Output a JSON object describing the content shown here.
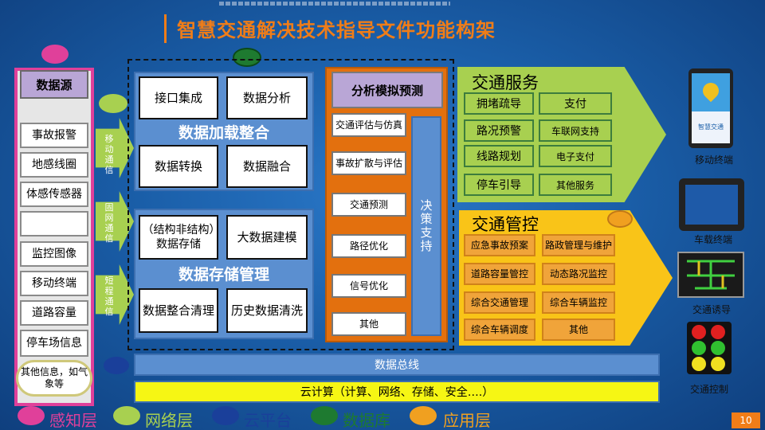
{
  "title": "智慧交通解决技术指导文件功能构架",
  "source": {
    "header": "数据源",
    "items": [
      "事故报警",
      "地感线圈",
      "体感传感器",
      "",
      "监控图像",
      "移动终端",
      "道路容量",
      "停车场信息"
    ],
    "other": "其他信息，如气象等"
  },
  "networks": [
    "移动通信",
    "固网通信",
    "短程通信"
  ],
  "load": {
    "title": "数据加载整合",
    "boxes": [
      "接口集成",
      "数据分析",
      "数据转换",
      "数据融合"
    ]
  },
  "storage": {
    "title": "数据存储管理",
    "boxes": [
      "（结构非结构）数据存储",
      "大数据建模",
      "数据整合清理",
      "历史数据清洗"
    ]
  },
  "analysis": {
    "header": "分析模拟预测",
    "items": [
      "交通评估与仿真",
      "事故扩散与评估",
      "交通预测",
      "路径优化",
      "信号优化",
      "其他"
    ],
    "decision": "决策支持"
  },
  "service": {
    "title": "交通服务",
    "items": [
      "拥堵疏导",
      "支付",
      "路况预警",
      "车联网支持",
      "线路规划",
      "电子支付",
      "停车引导",
      "其他服务"
    ]
  },
  "control": {
    "title": "交通管控",
    "items": [
      "应急事故预案",
      "路政管理与维护",
      "道路容量管控",
      "动态路况监控",
      "综合交通管理",
      "综合车辆监控",
      "综合车辆调度",
      "其他"
    ]
  },
  "bus": "数据总线",
  "cloud": "云计算（计算、网络、存储、安全….）",
  "devices": [
    "移动终端",
    "车载终端",
    "交通诱导",
    "交通控制"
  ],
  "phone_app": "智慧交通",
  "legend": [
    {
      "label": "感知层",
      "color": "#e0409a"
    },
    {
      "label": "网络层",
      "color": "#a8d050"
    },
    {
      "label": "云平台",
      "color": "#1a3f9a"
    },
    {
      "label": "数据库",
      "color": "#1e7a30"
    },
    {
      "label": "应用层",
      "color": "#f0a020"
    }
  ],
  "page_number": "10"
}
